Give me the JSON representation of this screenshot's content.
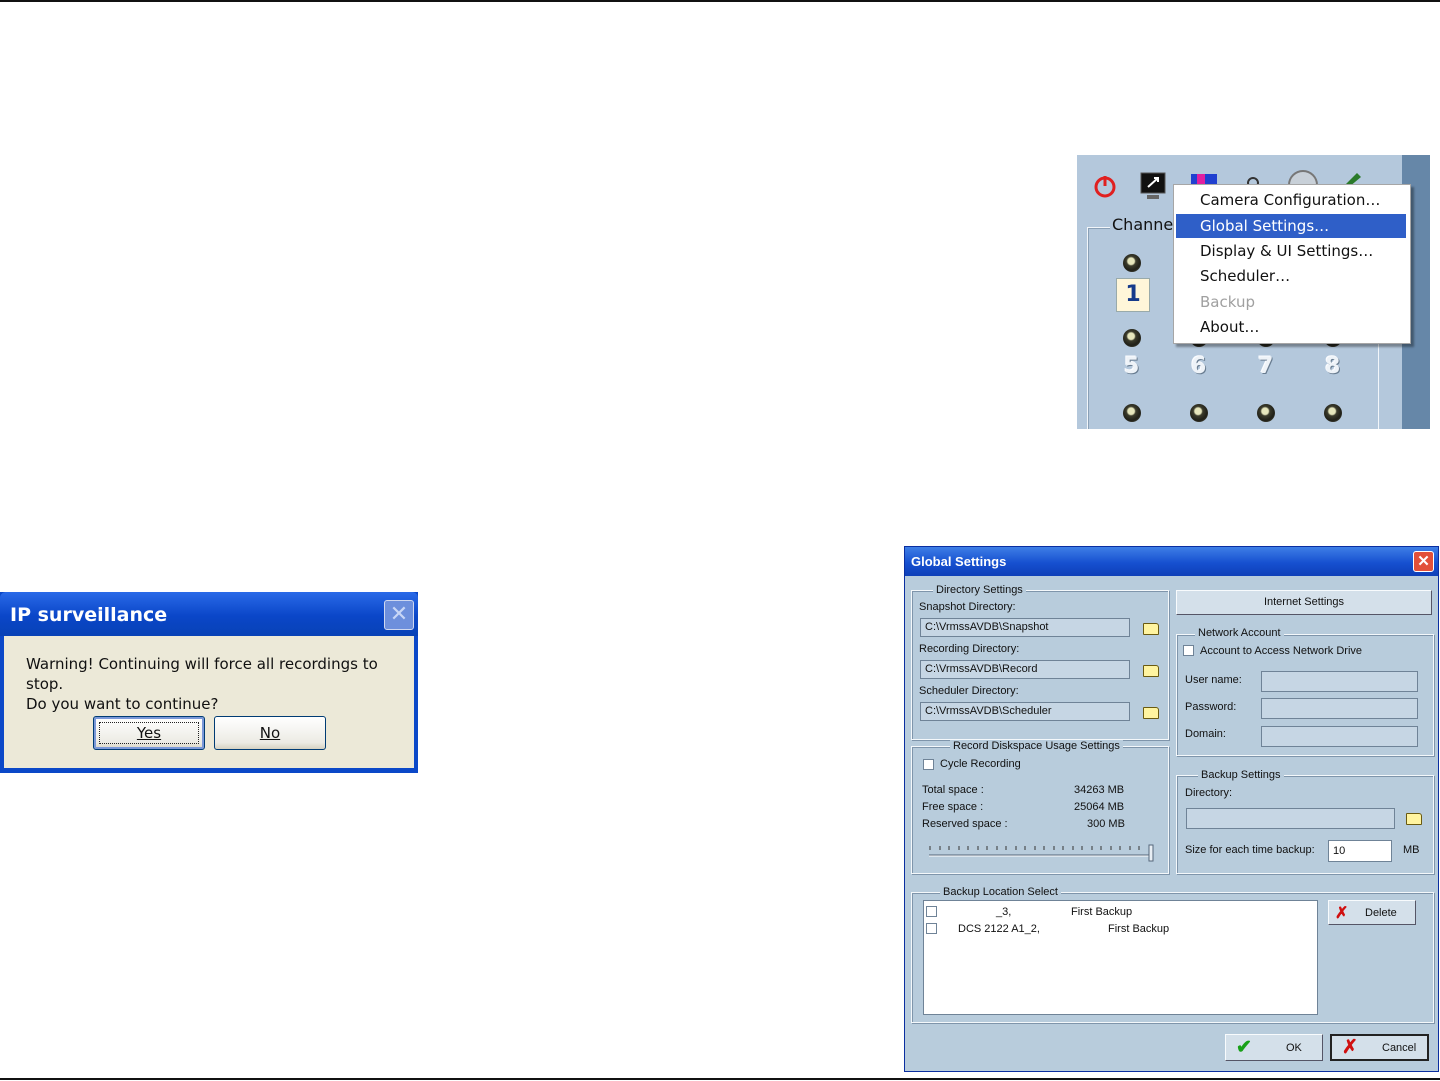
{
  "toolbar": {
    "channel_label": "Channel",
    "channel_numbers": [
      "1",
      "5",
      "6",
      "7",
      "8"
    ],
    "icons": [
      "power-icon",
      "monitor-icon",
      "color-display-icon",
      "camera-icon",
      "settings-wheel-icon",
      "tools-icon"
    ]
  },
  "menu": {
    "items": [
      {
        "label": "Camera Configuration…",
        "state": "normal"
      },
      {
        "label": "Global Settings…",
        "state": "selected"
      },
      {
        "label": "Display & UI Settings…",
        "state": "normal"
      },
      {
        "label": "Scheduler…",
        "state": "normal"
      },
      {
        "label": "Backup",
        "state": "disabled"
      },
      {
        "label": "About…",
        "state": "normal"
      }
    ],
    "highlight_color": "#2f5fc8"
  },
  "global_settings": {
    "title": "Global Settings",
    "directory_settings": {
      "title": "Directory Settings",
      "snapshot_label": "Snapshot Directory:",
      "snapshot_value": "C:\\VrmssAVDB\\Snapshot",
      "recording_label": "Recording Directory:",
      "recording_value": "C:\\VrmssAVDB\\Record",
      "scheduler_label": "Scheduler Directory:",
      "scheduler_value": "C:\\VrmssAVDB\\Scheduler"
    },
    "diskspace": {
      "title": "Record Diskspace Usage Settings",
      "cycle_label": "Cycle Recording",
      "total_label": "Total space :",
      "total_value": "34263 MB",
      "free_label": "Free space :",
      "free_value": "25064 MB",
      "reserved_label": "Reserved space :",
      "reserved_value": "300 MB"
    },
    "internet_button": "Internet Settings",
    "network_account": {
      "title": "Network Account",
      "access_label": "Account to Access Network Drive",
      "username_label": "User name:",
      "password_label": "Password:",
      "domain_label": "Domain:"
    },
    "backup_settings": {
      "title": "Backup Settings",
      "directory_label": "Directory:",
      "size_label": "Size for each time backup:",
      "size_value": "10",
      "size_unit": "MB"
    },
    "backup_location": {
      "title": "Backup Location Select",
      "rows": [
        {
          "camera": "_3,",
          "name": "First Backup"
        },
        {
          "camera": "DCS 2122  A1_2,",
          "name": "First Backup"
        }
      ],
      "delete_button": "Delete"
    },
    "ok_button": "OK",
    "cancel_button": "Cancel",
    "title_color": "#1650d0"
  },
  "warning_dialog": {
    "title": "IP surveillance",
    "message_line1": "Warning!  Continuing will force all recordings to stop.",
    "message_line2": "Do you want to continue?",
    "yes_button": "Yes",
    "no_button": "No"
  }
}
